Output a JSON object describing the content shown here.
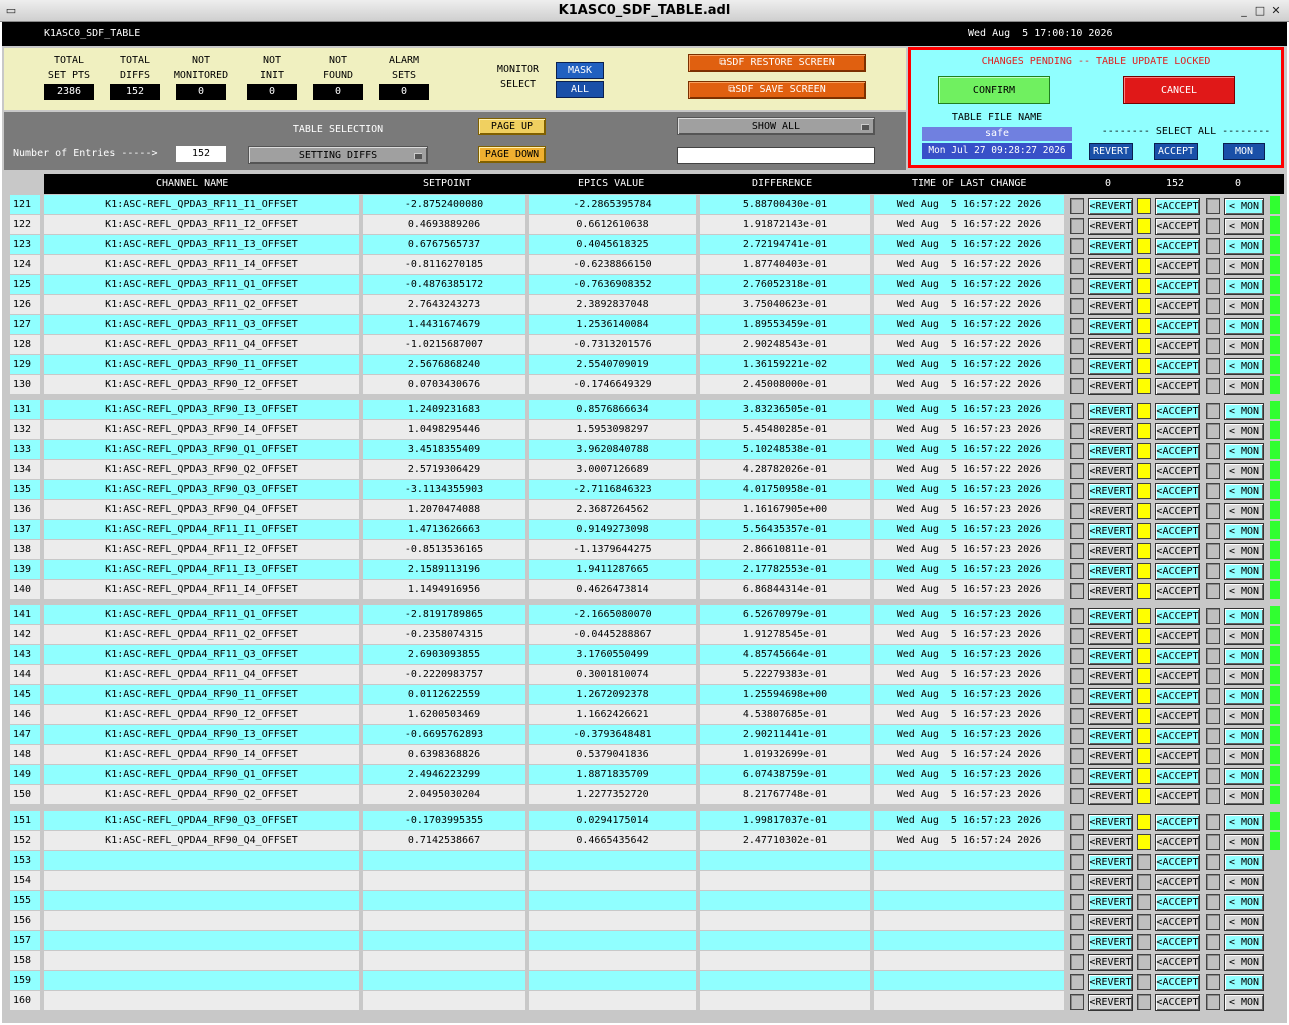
{
  "window": {
    "title": "K1ASC0_SDF_TABLE.adl"
  },
  "header": {
    "name": "K1ASC0_SDF_TABLE",
    "datetime": "Wed Aug  5 17:00:10 2026"
  },
  "stats": [
    {
      "label1": "TOTAL",
      "label2": "SET PTS",
      "value": "2386"
    },
    {
      "label1": "TOTAL",
      "label2": "DIFFS",
      "value": "152"
    },
    {
      "label1": "NOT",
      "label2": "MONITORED",
      "value": "0"
    },
    {
      "label1": "NOT",
      "label2": "INIT",
      "value": "0"
    },
    {
      "label1": "NOT",
      "label2": "FOUND",
      "value": "0"
    },
    {
      "label1": "ALARM",
      "label2": "SETS",
      "value": "0"
    }
  ],
  "monitor": {
    "label1": "MONITOR",
    "label2": "SELECT",
    "mask": "MASK",
    "all": "ALL"
  },
  "buttons": {
    "restore": "⧉SDF RESTORE SCREEN",
    "save": "⧉SDF SAVE SCREEN",
    "page_up": "PAGE UP",
    "page_down": "PAGE DOWN"
  },
  "controls": {
    "entries_label": "Number of Entries ----->",
    "entries_value": "152",
    "table_selection_label": "TABLE SELECTION",
    "table_selection": "SETTING DIFFS",
    "show": "SHOW ALL"
  },
  "pending": {
    "message": "CHANGES PENDING -- TABLE UPDATE LOCKED",
    "confirm": "CONFIRM",
    "cancel": "CANCEL",
    "file_label": "TABLE FILE NAME",
    "file_name": "safe",
    "file_date": "Mon Jul 27 09:28:27 2026",
    "select_all": "-------- SELECT ALL --------",
    "revert": "REVERT",
    "accept": "ACCEPT",
    "mon": "MON"
  },
  "columns": {
    "channel": "CHANNEL NAME",
    "setpoint": "SETPOINT",
    "epics": "EPICS VALUE",
    "difference": "DIFFERENCE",
    "time": "TIME OF LAST CHANGE",
    "count_revert": "0",
    "count_accept": "152",
    "count_mon": "0"
  },
  "row_buttons": {
    "revert": "<REVERT",
    "accept": "<ACCEPT",
    "mon": "< MON"
  },
  "rows": [
    {
      "n": "121",
      "ch": "K1:ASC-REFL_QPDA3_RF11_I1_OFFSET",
      "sp": "-2.8752400080",
      "ev": "-2.2865395784",
      "df": "5.88700430e-01",
      "t": "Wed Aug  5 16:57:22 2026"
    },
    {
      "n": "122",
      "ch": "K1:ASC-REFL_QPDA3_RF11_I2_OFFSET",
      "sp": "0.4693889206",
      "ev": "0.6612610638",
      "df": "1.91872143e-01",
      "t": "Wed Aug  5 16:57:22 2026"
    },
    {
      "n": "123",
      "ch": "K1:ASC-REFL_QPDA3_RF11_I3_OFFSET",
      "sp": "0.6767565737",
      "ev": "0.4045618325",
      "df": "2.72194741e-01",
      "t": "Wed Aug  5 16:57:22 2026"
    },
    {
      "n": "124",
      "ch": "K1:ASC-REFL_QPDA3_RF11_I4_OFFSET",
      "sp": "-0.8116270185",
      "ev": "-0.6238866150",
      "df": "1.87740403e-01",
      "t": "Wed Aug  5 16:57:22 2026"
    },
    {
      "n": "125",
      "ch": "K1:ASC-REFL_QPDA3_RF11_Q1_OFFSET",
      "sp": "-0.4876385172",
      "ev": "-0.7636908352",
      "df": "2.76052318e-01",
      "t": "Wed Aug  5 16:57:22 2026"
    },
    {
      "n": "126",
      "ch": "K1:ASC-REFL_QPDA3_RF11_Q2_OFFSET",
      "sp": "2.7643243273",
      "ev": "2.3892837048",
      "df": "3.75040623e-01",
      "t": "Wed Aug  5 16:57:22 2026"
    },
    {
      "n": "127",
      "ch": "K1:ASC-REFL_QPDA3_RF11_Q3_OFFSET",
      "sp": "1.4431674679",
      "ev": "1.2536140084",
      "df": "1.89553459e-01",
      "t": "Wed Aug  5 16:57:22 2026"
    },
    {
      "n": "128",
      "ch": "K1:ASC-REFL_QPDA3_RF11_Q4_OFFSET",
      "sp": "-1.0215687007",
      "ev": "-0.7313201576",
      "df": "2.90248543e-01",
      "t": "Wed Aug  5 16:57:22 2026"
    },
    {
      "n": "129",
      "ch": "K1:ASC-REFL_QPDA3_RF90_I1_OFFSET",
      "sp": "2.5676868240",
      "ev": "2.5540709019",
      "df": "1.36159221e-02",
      "t": "Wed Aug  5 16:57:22 2026"
    },
    {
      "n": "130",
      "ch": "K1:ASC-REFL_QPDA3_RF90_I2_OFFSET",
      "sp": "0.0703430676",
      "ev": "-0.1746649329",
      "df": "2.45008000e-01",
      "t": "Wed Aug  5 16:57:22 2026"
    },
    {
      "n": "131",
      "ch": "K1:ASC-REFL_QPDA3_RF90_I3_OFFSET",
      "sp": "1.2409231683",
      "ev": "0.8576866634",
      "df": "3.83236505e-01",
      "t": "Wed Aug  5 16:57:23 2026"
    },
    {
      "n": "132",
      "ch": "K1:ASC-REFL_QPDA3_RF90_I4_OFFSET",
      "sp": "1.0498295446",
      "ev": "1.5953098297",
      "df": "5.45480285e-01",
      "t": "Wed Aug  5 16:57:23 2026"
    },
    {
      "n": "133",
      "ch": "K1:ASC-REFL_QPDA3_RF90_Q1_OFFSET",
      "sp": "3.4518355409",
      "ev": "3.9620840788",
      "df": "5.10248538e-01",
      "t": "Wed Aug  5 16:57:22 2026"
    },
    {
      "n": "134",
      "ch": "K1:ASC-REFL_QPDA3_RF90_Q2_OFFSET",
      "sp": "2.5719306429",
      "ev": "3.0007126689",
      "df": "4.28782026e-01",
      "t": "Wed Aug  5 16:57:22 2026"
    },
    {
      "n": "135",
      "ch": "K1:ASC-REFL_QPDA3_RF90_Q3_OFFSET",
      "sp": "-3.1134355903",
      "ev": "-2.7116846323",
      "df": "4.01750958e-01",
      "t": "Wed Aug  5 16:57:23 2026"
    },
    {
      "n": "136",
      "ch": "K1:ASC-REFL_QPDA3_RF90_Q4_OFFSET",
      "sp": "1.2070474088",
      "ev": "2.3687264562",
      "df": "1.16167905e+00",
      "t": "Wed Aug  5 16:57:23 2026"
    },
    {
      "n": "137",
      "ch": "K1:ASC-REFL_QPDA4_RF11_I1_OFFSET",
      "sp": "1.4713626663",
      "ev": "0.9149273098",
      "df": "5.56435357e-01",
      "t": "Wed Aug  5 16:57:23 2026"
    },
    {
      "n": "138",
      "ch": "K1:ASC-REFL_QPDA4_RF11_I2_OFFSET",
      "sp": "-0.8513536165",
      "ev": "-1.1379644275",
      "df": "2.86610811e-01",
      "t": "Wed Aug  5 16:57:23 2026"
    },
    {
      "n": "139",
      "ch": "K1:ASC-REFL_QPDA4_RF11_I3_OFFSET",
      "sp": "2.1589113196",
      "ev": "1.9411287665",
      "df": "2.17782553e-01",
      "t": "Wed Aug  5 16:57:23 2026"
    },
    {
      "n": "140",
      "ch": "K1:ASC-REFL_QPDA4_RF11_I4_OFFSET",
      "sp": "1.1494916956",
      "ev": "0.4626473814",
      "df": "6.86844314e-01",
      "t": "Wed Aug  5 16:57:23 2026"
    },
    {
      "n": "141",
      "ch": "K1:ASC-REFL_QPDA4_RF11_Q1_OFFSET",
      "sp": "-2.8191789865",
      "ev": "-2.1665080070",
      "df": "6.52670979e-01",
      "t": "Wed Aug  5 16:57:23 2026"
    },
    {
      "n": "142",
      "ch": "K1:ASC-REFL_QPDA4_RF11_Q2_OFFSET",
      "sp": "-0.2358074315",
      "ev": "-0.0445288867",
      "df": "1.91278545e-01",
      "t": "Wed Aug  5 16:57:23 2026"
    },
    {
      "n": "143",
      "ch": "K1:ASC-REFL_QPDA4_RF11_Q3_OFFSET",
      "sp": "2.6903093855",
      "ev": "3.1760550499",
      "df": "4.85745664e-01",
      "t": "Wed Aug  5 16:57:23 2026"
    },
    {
      "n": "144",
      "ch": "K1:ASC-REFL_QPDA4_RF11_Q4_OFFSET",
      "sp": "-0.2220983757",
      "ev": "0.3001810074",
      "df": "5.22279383e-01",
      "t": "Wed Aug  5 16:57:23 2026"
    },
    {
      "n": "145",
      "ch": "K1:ASC-REFL_QPDA4_RF90_I1_OFFSET",
      "sp": "0.0112622559",
      "ev": "1.2672092378",
      "df": "1.25594698e+00",
      "t": "Wed Aug  5 16:57:23 2026"
    },
    {
      "n": "146",
      "ch": "K1:ASC-REFL_QPDA4_RF90_I2_OFFSET",
      "sp": "1.6200503469",
      "ev": "1.1662426621",
      "df": "4.53807685e-01",
      "t": "Wed Aug  5 16:57:23 2026"
    },
    {
      "n": "147",
      "ch": "K1:ASC-REFL_QPDA4_RF90_I3_OFFSET",
      "sp": "-0.6695762893",
      "ev": "-0.3793648481",
      "df": "2.90211441e-01",
      "t": "Wed Aug  5 16:57:23 2026"
    },
    {
      "n": "148",
      "ch": "K1:ASC-REFL_QPDA4_RF90_I4_OFFSET",
      "sp": "0.6398368826",
      "ev": "0.5379041836",
      "df": "1.01932699e-01",
      "t": "Wed Aug  5 16:57:24 2026"
    },
    {
      "n": "149",
      "ch": "K1:ASC-REFL_QPDA4_RF90_Q1_OFFSET",
      "sp": "2.4946223299",
      "ev": "1.8871835709",
      "df": "6.07438759e-01",
      "t": "Wed Aug  5 16:57:23 2026"
    },
    {
      "n": "150",
      "ch": "K1:ASC-REFL_QPDA4_RF90_Q2_OFFSET",
      "sp": "2.0495030204",
      "ev": "1.2277352720",
      "df": "8.21767748e-01",
      "t": "Wed Aug  5 16:57:23 2026"
    },
    {
      "n": "151",
      "ch": "K1:ASC-REFL_QPDA4_RF90_Q3_OFFSET",
      "sp": "-0.1703995355",
      "ev": "0.0294175014",
      "df": "1.99817037e-01",
      "t": "Wed Aug  5 16:57:23 2026"
    },
    {
      "n": "152",
      "ch": "K1:ASC-REFL_QPDA4_RF90_Q4_OFFSET",
      "sp": "0.7142538667",
      "ev": "0.4665435642",
      "df": "2.47710302e-01",
      "t": "Wed Aug  5 16:57:24 2026"
    },
    {
      "n": "153",
      "ch": "",
      "sp": "",
      "ev": "",
      "df": "",
      "t": ""
    },
    {
      "n": "154",
      "ch": "",
      "sp": "",
      "ev": "",
      "df": "",
      "t": ""
    },
    {
      "n": "155",
      "ch": "",
      "sp": "",
      "ev": "",
      "df": "",
      "t": ""
    },
    {
      "n": "156",
      "ch": "",
      "sp": "",
      "ev": "",
      "df": "",
      "t": ""
    },
    {
      "n": "157",
      "ch": "",
      "sp": "",
      "ev": "",
      "df": "",
      "t": ""
    },
    {
      "n": "158",
      "ch": "",
      "sp": "",
      "ev": "",
      "df": "",
      "t": ""
    },
    {
      "n": "159",
      "ch": "",
      "sp": "",
      "ev": "",
      "df": "",
      "t": ""
    },
    {
      "n": "160",
      "ch": "",
      "sp": "",
      "ev": "",
      "df": "",
      "t": ""
    }
  ]
}
